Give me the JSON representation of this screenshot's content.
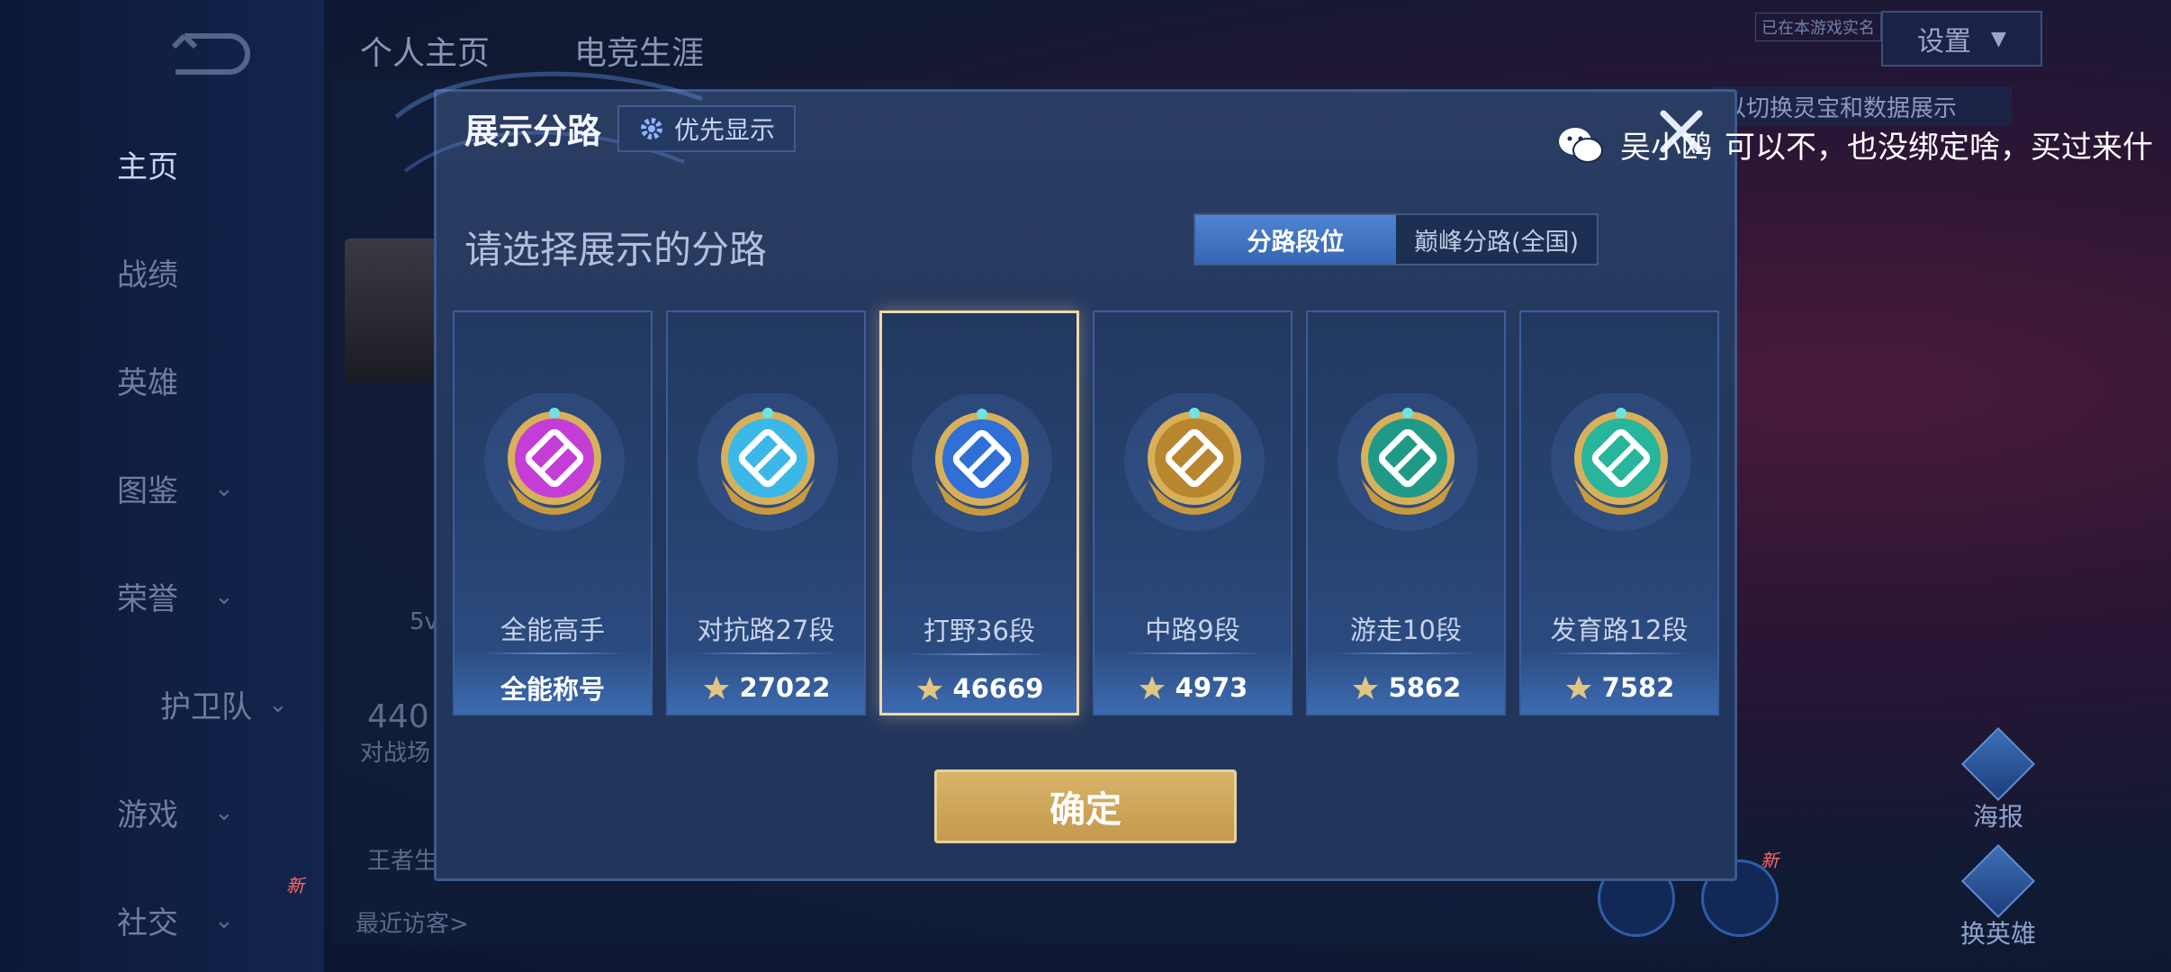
{
  "header": {
    "tabs": [
      "个人主页",
      "电竞生涯"
    ],
    "settings_label": "设置",
    "small_tag": "已在本游戏实名",
    "hint": "以切换灵宝和数据展示"
  },
  "sidebar": {
    "items": [
      {
        "label": "主页"
      },
      {
        "label": "战绩"
      },
      {
        "label": "英雄"
      },
      {
        "label": "图鉴"
      },
      {
        "label": "荣誉"
      },
      {
        "label": "护卫队"
      },
      {
        "label": "游戏"
      },
      {
        "label": "社交"
      }
    ],
    "new_badge": "新"
  },
  "background": {
    "stat_value": "440",
    "stat_label": "对战场",
    "visitors_label": "最近访客>",
    "king_text": "王者生",
    "mode_text": "5v",
    "new_badge_2": "新"
  },
  "right_buttons": [
    "海报",
    "换英雄"
  ],
  "chat": {
    "sender": "吴小鸥",
    "text": "可以不，也没绑定啥，买过来什"
  },
  "modal": {
    "title": "展示分路",
    "priority_label": "优先显示",
    "subtitle": "请选择展示的分路",
    "toggle": [
      {
        "label": "分路段位",
        "active": true
      },
      {
        "label": "巅峰分路(全国)",
        "active": false
      }
    ],
    "cards": [
      {
        "lane": "全能高手",
        "score": "全能称号",
        "has_points_icon": false,
        "selected": false,
        "color": "#c43dd6",
        "icon": "allround-badge-icon"
      },
      {
        "lane": "对抗路27段",
        "score": "27022",
        "has_points_icon": true,
        "selected": false,
        "color": "#3bb8e8",
        "icon": "clash-lane-badge-icon"
      },
      {
        "lane": "打野36段",
        "score": "46669",
        "has_points_icon": true,
        "selected": true,
        "color": "#2f6fd6",
        "icon": "jungle-badge-icon"
      },
      {
        "lane": "中路9段",
        "score": "4973",
        "has_points_icon": true,
        "selected": false,
        "color": "#b8862f",
        "icon": "mid-lane-badge-icon"
      },
      {
        "lane": "游走10段",
        "score": "5862",
        "has_points_icon": true,
        "selected": false,
        "color": "#1f9a86",
        "icon": "roam-badge-icon"
      },
      {
        "lane": "发育路12段",
        "score": "7582",
        "has_points_icon": true,
        "selected": false,
        "color": "#27b59c",
        "icon": "farm-lane-badge-icon"
      }
    ],
    "confirm_label": "确定"
  }
}
